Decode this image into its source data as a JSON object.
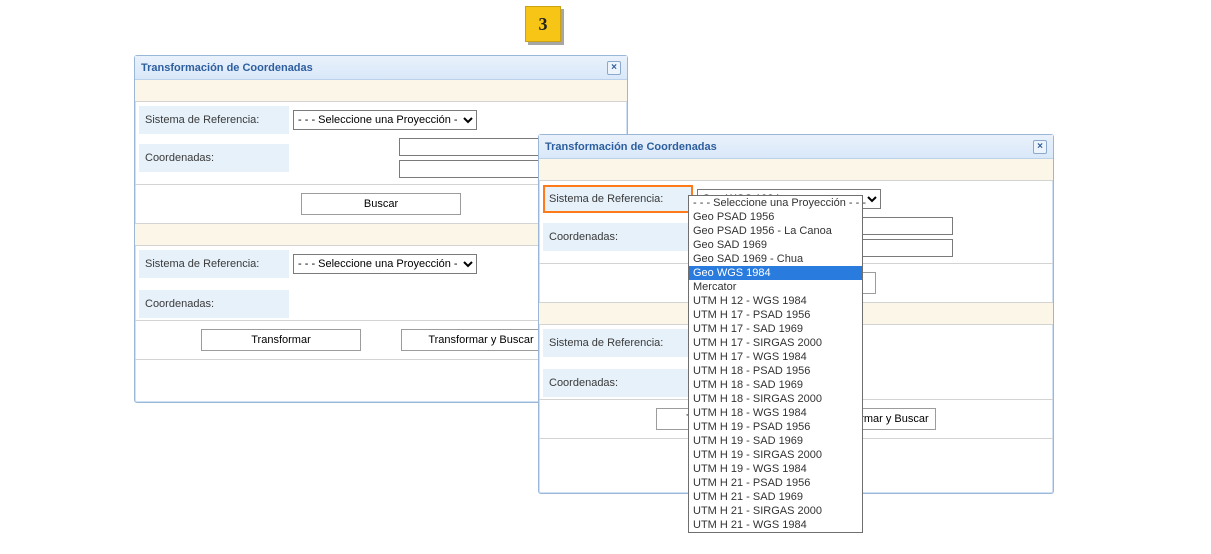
{
  "step": "3",
  "title": "Transformación de Coordenadas",
  "labels": {
    "refSystem": "Sistema de Referencia:",
    "coords": "Coordenadas:"
  },
  "buttons": {
    "search": "Buscar",
    "transform": "Transformar",
    "transformSearch": "Transformar y Buscar"
  },
  "select": {
    "placeholder": "- - - Seleccione una Proyección - - -",
    "currentRight": "Geo WGS 1984",
    "highlighted": "Geo WGS 1984",
    "options": [
      "- - - Seleccione una Proyección - - -",
      "Geo PSAD 1956",
      "Geo PSAD 1956 - La Canoa",
      "Geo SAD 1969",
      "Geo SAD 1969 - Chua",
      "Geo WGS 1984",
      "Mercator",
      "UTM H 12 - WGS 1984",
      "UTM H 17 - PSAD 1956",
      "UTM H 17 - SAD 1969",
      "UTM H 17 - SIRGAS 2000",
      "UTM H 17 - WGS 1984",
      "UTM H 18 - PSAD 1956",
      "UTM H 18 - SAD 1969",
      "UTM H 18 - SIRGAS 2000",
      "UTM H 18 - WGS 1984",
      "UTM H 19 - PSAD 1956",
      "UTM H 19 - SAD 1969",
      "UTM H 19 - SIRGAS 2000",
      "UTM H 19 - WGS 1984",
      "UTM H 21 - PSAD 1956",
      "UTM H 21 - SAD 1969",
      "UTM H 21 - SIRGAS 2000",
      "UTM H 21 - WGS 1984"
    ]
  }
}
